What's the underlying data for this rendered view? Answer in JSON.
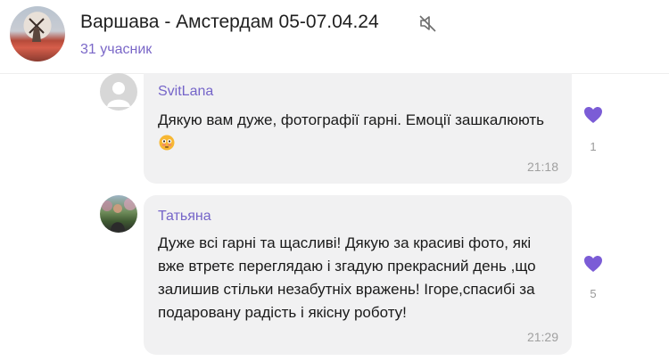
{
  "chat": {
    "title": "Варшава - Амстердам 05-07.04.24",
    "members": "31 учасник"
  },
  "messages": [
    {
      "author": "SvitLana",
      "text": "Дякую вам дуже, фотографії гарні. Емоції зашкалюють",
      "emoji": "flushed-face",
      "time": "21:18",
      "reaction": {
        "icon": "purple-heart",
        "count": "1"
      }
    },
    {
      "author": "Татьяна",
      "text": "Дуже всі  гарні та щасливі! Дякую за красиві фото, які вже втретє переглядаю і згадую прекрасний день ,що залишив стільки незабутніх вражень! Ігоре,спасибі за подаровану радість і якісну роботу!",
      "time": "21:29",
      "reaction": {
        "icon": "purple-heart",
        "count": "5"
      }
    }
  ],
  "colors": {
    "accent": "#7565c9",
    "bubble": "#f1f1f2",
    "heart": "#7b5cd6"
  }
}
